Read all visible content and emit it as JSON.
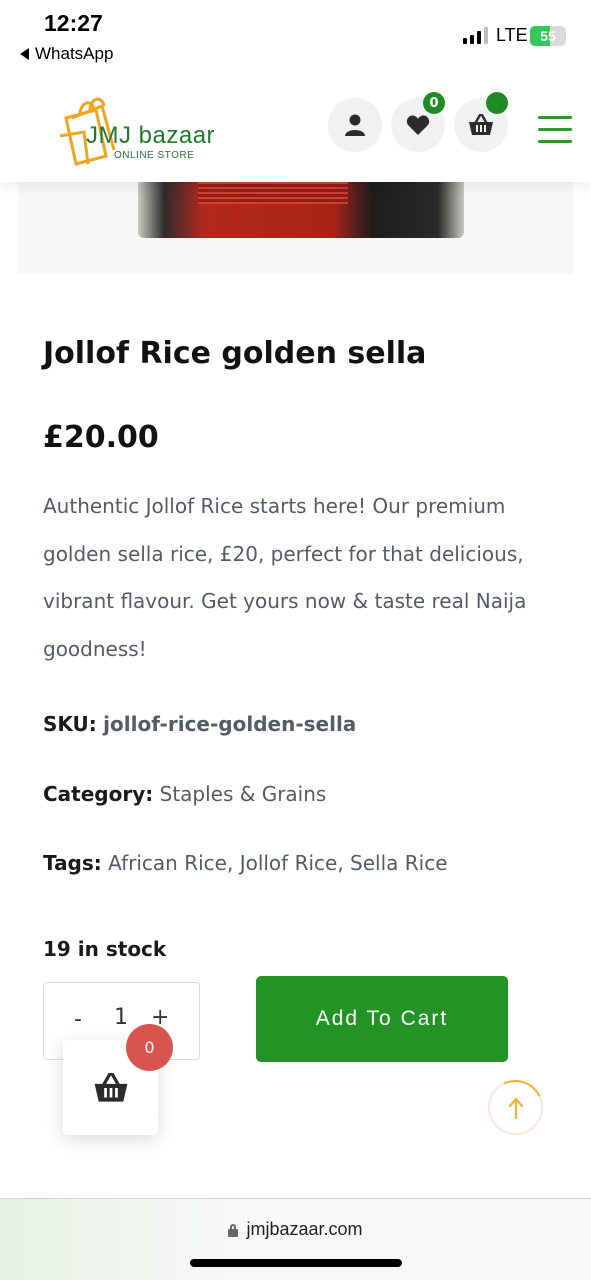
{
  "status_bar": {
    "time": "12:27",
    "back_label": "WhatsApp",
    "network": "LTE",
    "battery_level": "55",
    "battery_fraction": 0.55
  },
  "header": {
    "logo_brand": "JMJ bazaar",
    "logo_tagline": "ONLINE STORE",
    "wishlist_count": "0",
    "icons": [
      "user-icon",
      "heart-icon",
      "basket-icon",
      "hamburger-menu-icon"
    ],
    "accent_color": "#249326"
  },
  "product": {
    "title": "Jollof Rice golden sella",
    "price": "£20.00",
    "description": "Authentic Jollof Rice starts here! Our premium golden sella rice, £20, perfect for that delicious, vibrant flavour. Get yours now & taste real Naija goodness!",
    "sku_label": "SKU:",
    "sku_value": "jollof-rice-golden-sella",
    "category_label": "Category:",
    "category_value": "Staples & Grains",
    "tags_label": "Tags:",
    "tags": [
      "African Rice",
      "Jollof Rice",
      "Sella Rice"
    ],
    "tag_separator": ",",
    "stock": "19 in stock"
  },
  "cart_form": {
    "qty_minus": "-",
    "qty_value": "1",
    "qty_plus": "+",
    "add_to_cart_label": "Add To Cart"
  },
  "floating_cart": {
    "count": "0"
  },
  "browser": {
    "url": "jmjbazaar.com"
  }
}
